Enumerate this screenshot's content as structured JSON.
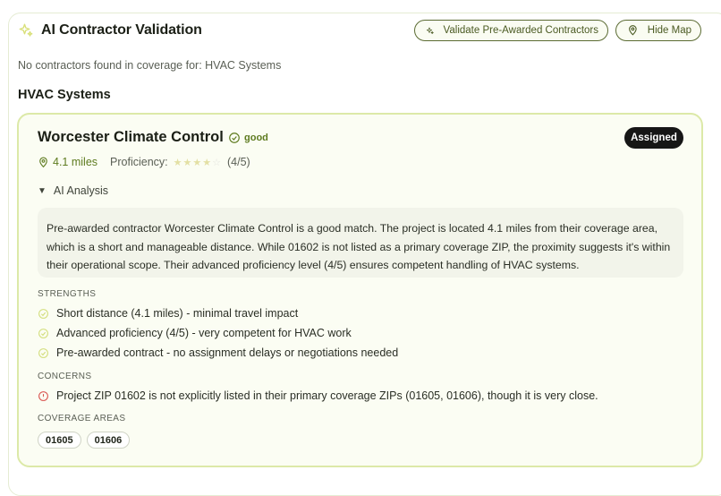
{
  "header": {
    "title": "AI Contractor Validation",
    "validate_label": "Validate Pre-Awarded Contractors",
    "hide_map_label": "Hide Map"
  },
  "status_message": "No contractors found in coverage for: HVAC Systems",
  "section": {
    "title": "HVAC Systems"
  },
  "contractor": {
    "name": "Worcester Climate Control",
    "quality": "good",
    "assigned_label": "Assigned",
    "distance": "4.1 miles",
    "proficiency_label": "Proficiency:",
    "proficiency_rating": 4,
    "proficiency_max": 5,
    "proficiency_text": "(4/5)",
    "ai_toggle_label": "AI Analysis",
    "analysis_text": "Pre-awarded contractor Worcester Climate Control is a good match. The project is located 4.1 miles from their coverage area, which is a short and manageable distance. While 01602 is not listed as a primary coverage ZIP, the proximity suggests it's within their operational scope. Their advanced proficiency level (4/5) ensures competent handling of HVAC systems.",
    "strengths_label": "STRENGTHS",
    "strengths": [
      "Short distance (4.1 miles) - minimal travel impact",
      "Advanced proficiency (4/5) - very competent for HVAC work",
      "Pre-awarded contract - no assignment delays or negotiations needed"
    ],
    "concerns_label": "CONCERNS",
    "concerns": [
      "Project ZIP 01602 is not explicitly listed in their primary coverage ZIPs (01605, 01606), though it is very close."
    ],
    "coverage_label": "COVERAGE AREAS",
    "coverage_areas": [
      "01605",
      "01606"
    ]
  },
  "colors": {
    "accent_green": "#5e7b1f",
    "card_border": "#dce9a8",
    "concern_red": "#d9534f",
    "assigned_bg": "#161616"
  },
  "icons": {
    "title": "sparkles-icon",
    "validate": "sparkles-icon",
    "hide_map": "map-pin-icon",
    "quality": "check-circle-icon",
    "distance": "map-pin-icon",
    "strength": "check-circle-icon",
    "concern": "alert-circle-icon"
  }
}
